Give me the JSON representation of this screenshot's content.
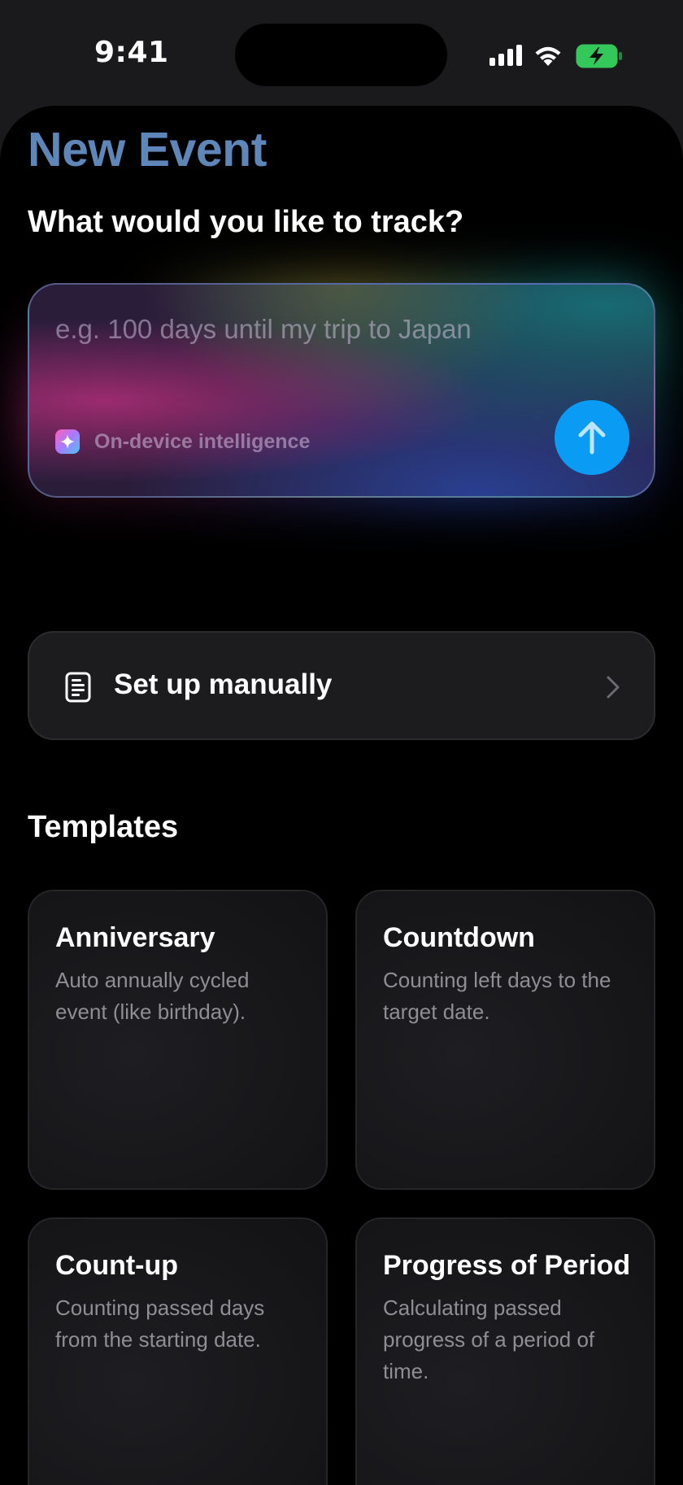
{
  "status_bar": {
    "time": "9:41",
    "icons": [
      "signal-icon",
      "wifi-icon",
      "battery-charging-icon"
    ]
  },
  "colors": {
    "title_accent": "#5f86b8",
    "send_button": "#0a9cf5",
    "battery": "#34c759",
    "background": "#000000"
  },
  "page": {
    "title": "New Event",
    "prompt_heading": "What would you like to track?"
  },
  "prompt_card": {
    "placeholder": "e.g. 100 days until my trip to Japan",
    "value": "",
    "intelligence_label": "On-device intelligence",
    "send_icon": "arrow-up-icon"
  },
  "manual": {
    "label": "Set up manually",
    "icon": "document-icon",
    "chevron": "chevron-right-icon"
  },
  "templates": {
    "heading": "Templates",
    "items": [
      {
        "title": "Anniversary",
        "description": "Auto annually cycled event (like birthday)."
      },
      {
        "title": "Countdown",
        "description": "Counting left days to the target date."
      },
      {
        "title": "Count-up",
        "description": "Counting passed days from the starting date."
      },
      {
        "title": "Progress of Period",
        "description": "Calculating passed progress of a period of time."
      }
    ]
  }
}
